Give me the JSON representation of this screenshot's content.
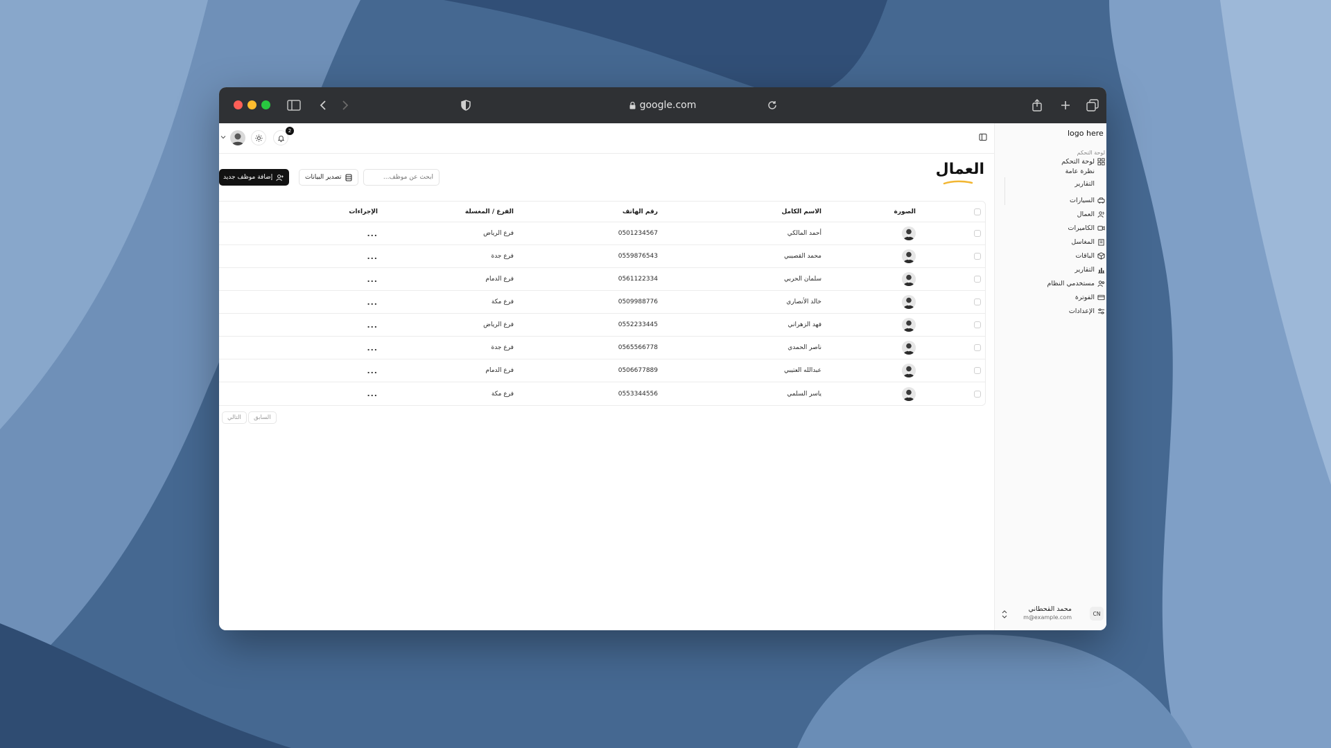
{
  "browser": {
    "url": "google.com"
  },
  "topbar": {
    "notification_count": "2"
  },
  "sidebar": {
    "logo": "logo here",
    "group_label": "لوحة التحكم",
    "items": [
      {
        "label": "لوحة التحكم",
        "icon": "dashboard-icon"
      },
      {
        "label": "السيارات",
        "icon": "car-icon"
      },
      {
        "label": "العمال",
        "icon": "users-icon"
      },
      {
        "label": "الكاميرات",
        "icon": "camera-icon"
      },
      {
        "label": "المغاسل",
        "icon": "building-icon"
      },
      {
        "label": "الباقات",
        "icon": "package-icon"
      },
      {
        "label": "التقارير",
        "icon": "chart-icon"
      },
      {
        "label": "مستخدمي النظام",
        "icon": "user-group-icon"
      },
      {
        "label": "الفوترة",
        "icon": "card-icon"
      },
      {
        "label": "الإعدادات",
        "icon": "settings-icon"
      }
    ],
    "sub_items": [
      "نظرة عامة",
      "التقارير"
    ],
    "user": {
      "name": "محمد القحطاني",
      "email": "m@example.com",
      "initials": "CN"
    }
  },
  "page": {
    "title": "العمال",
    "add_button": "إضافة موظف جديد",
    "export_button": "تصدير البيانات",
    "search_placeholder": "ابحث عن موظف..."
  },
  "table": {
    "columns": [
      "الصورة",
      "الاسم الكامل",
      "رقم الهاتف",
      "الفرع / المغسلة",
      "الإجراءات"
    ],
    "rows": [
      {
        "name": "أحمد المالكي",
        "phone": "0501234567",
        "branch": "فرع الرياض",
        "actions": "..."
      },
      {
        "name": "محمد القصيبي",
        "phone": "0559876543",
        "branch": "فرع جدة",
        "actions": "..."
      },
      {
        "name": "سلمان الحربي",
        "phone": "0561122334",
        "branch": "فرع الدمام",
        "actions": "..."
      },
      {
        "name": "خالد الأنصاري",
        "phone": "0509988776",
        "branch": "فرع مكة",
        "actions": "..."
      },
      {
        "name": "فهد الزهراني",
        "phone": "0552233445",
        "branch": "فرع الرياض",
        "actions": "..."
      },
      {
        "name": "ناصر الحمدي",
        "phone": "0565566778",
        "branch": "فرع جدة",
        "actions": "..."
      },
      {
        "name": "عبدالله العتيبي",
        "phone": "0506677889",
        "branch": "فرع الدمام",
        "actions": "..."
      },
      {
        "name": "ياسر السلمي",
        "phone": "0553344556",
        "branch": "فرع مكة",
        "actions": "..."
      }
    ]
  },
  "pagination": {
    "previous": "السابق",
    "next": "التالي"
  }
}
